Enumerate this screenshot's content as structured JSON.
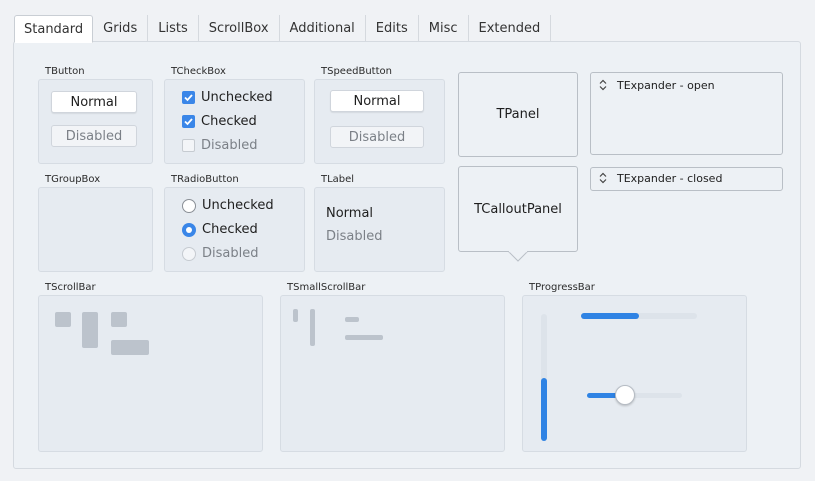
{
  "tabs": [
    "Standard",
    "Grids",
    "Lists",
    "ScrollBox",
    "Additional",
    "Edits",
    "Misc",
    "Extended"
  ],
  "tbutton": {
    "caption": "TButton",
    "normal": "Normal",
    "disabled": "Disabled"
  },
  "tcheckbox": {
    "caption": "TCheckBox",
    "unchecked": "Unchecked",
    "checked": "Checked",
    "disabled": "Disabled"
  },
  "tspeedbutton": {
    "caption": "TSpeedButton",
    "normal": "Normal",
    "disabled": "Disabled"
  },
  "tpanel": {
    "label": "TPanel"
  },
  "tcalloutpanel": {
    "label": "TCalloutPanel"
  },
  "texpander_open": {
    "label": "TExpander - open"
  },
  "texpander_closed": {
    "label": "TExpander - closed"
  },
  "tgroupbox": {
    "caption": "TGroupBox"
  },
  "tradiobutton": {
    "caption": "TRadioButton",
    "unchecked": "Unchecked",
    "checked": "Checked",
    "disabled": "Disabled"
  },
  "tlabel": {
    "caption": "TLabel",
    "normal": "Normal",
    "disabled": "Disabled"
  },
  "tscrollbar": {
    "caption": "TScrollBar"
  },
  "tsmallscrollbar": {
    "caption": "TSmallScrollBar"
  },
  "tprogressbar": {
    "caption": "TProgressBar",
    "horizontal_progress": 0.5,
    "vertical_progress": 0.5,
    "trackbar_position": 0.4
  },
  "colors": {
    "accent": "#2f83e4",
    "check": "#3a86e8"
  }
}
